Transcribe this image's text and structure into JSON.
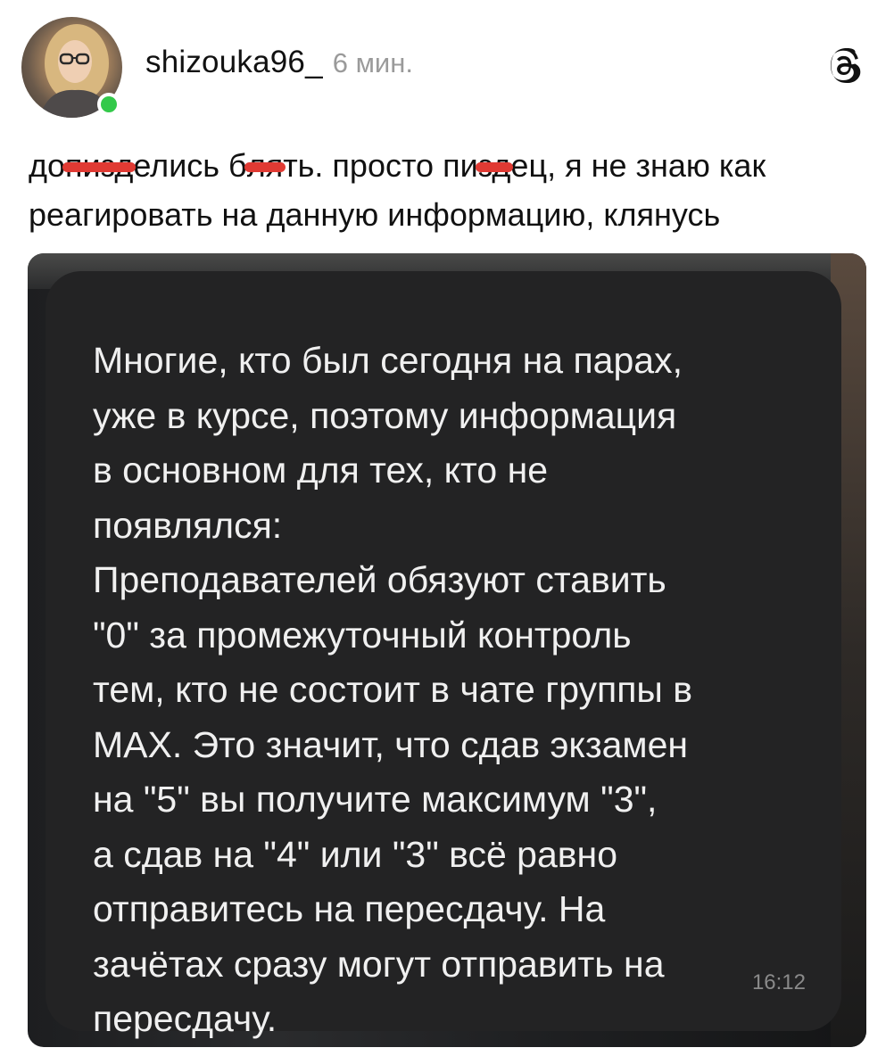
{
  "post": {
    "author": {
      "username": "shizouka96_",
      "avatar_icon": "profile-photo",
      "online": true
    },
    "time_ago": "6 мин.",
    "app_icon": "threads-icon",
    "caption": {
      "line1": [
        {
          "text": "до",
          "censored": false
        },
        {
          "text": "пизд",
          "censored": true
        },
        {
          "text": "елись б",
          "censored": false
        },
        {
          "text": "ля",
          "censored": true
        },
        {
          "text": "ть. просто пи",
          "censored": false
        },
        {
          "text": "зд",
          "censored": true
        },
        {
          "text": "ец, я не знаю как",
          "censored": false
        }
      ],
      "line2": "реагировать на данную информацию, клянусь"
    },
    "media": {
      "message_lines": [
        "Многие, кто был сегодня на парах,",
        "уже в курсе, поэтому информация",
        "в основном для тех, кто не",
        "появлялся:",
        "Преподавателей обязуют ставить",
        "\"0\" за промежуточный контроль",
        "тем, кто не состоит в чате группы в",
        "MAX. Это значит, что сдав экзамен",
        "на \"5\" вы получите максимум \"3\",",
        "а сдав на \"4\" или \"3\" всё равно",
        "отправитесь на пересдачу. На",
        "зачётах сразу могут отправить на",
        "пересдачу."
      ],
      "message_time": "16:12"
    }
  },
  "colors": {
    "accent_online": "#33c94a",
    "censor_mark": "#e03a33",
    "bubble_bg": "#232324"
  }
}
